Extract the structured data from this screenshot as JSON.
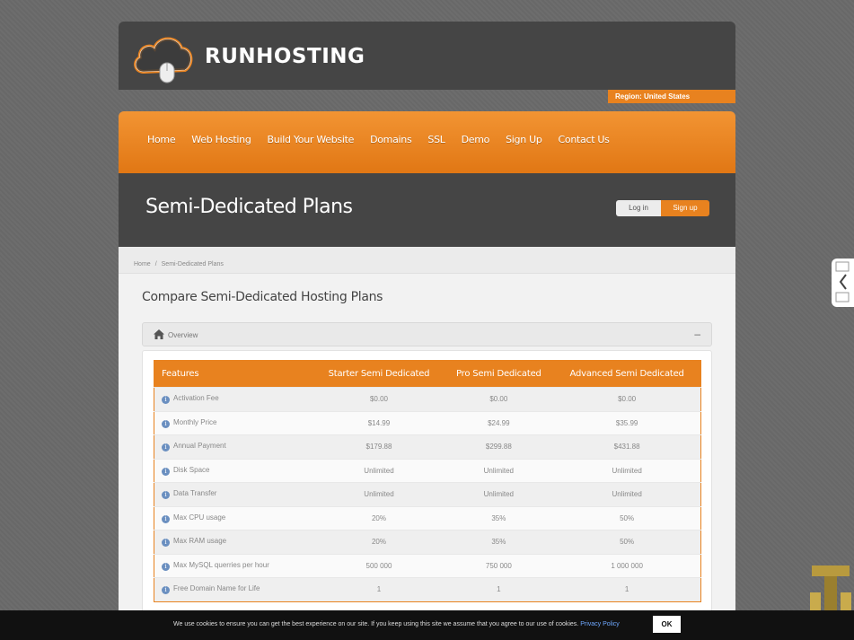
{
  "header": {
    "brand": "RUNHOSTING",
    "region": "Region: United States"
  },
  "nav": {
    "items": [
      {
        "label": "Home"
      },
      {
        "label": "Web Hosting"
      },
      {
        "label": "Build Your Website"
      },
      {
        "label": "Domains"
      },
      {
        "label": "SSL"
      },
      {
        "label": "Demo"
      },
      {
        "label": "Sign Up"
      },
      {
        "label": "Contact Us"
      }
    ]
  },
  "hero": {
    "title": "Semi-Dedicated Plans",
    "login_label": "Log in",
    "signup_label": "Sign up"
  },
  "breadcrumb": {
    "home": "Home",
    "separator": "/",
    "current": "Semi-Dedicated Plans"
  },
  "main": {
    "heading": "Compare Semi-Dedicated Hosting Plans",
    "accordion_label": "Overview",
    "accordion_toggle": "–"
  },
  "table": {
    "columns": [
      "Features",
      "Starter Semi Dedicated",
      "Pro Semi Dedicated",
      "Advanced Semi Dedicated"
    ],
    "rows": [
      [
        "Activation Fee",
        "$0.00",
        "$0.00",
        "$0.00"
      ],
      [
        "Monthly Price",
        "$14.99",
        "$24.99",
        "$35.99"
      ],
      [
        "Annual Payment",
        "$179.88",
        "$299.88",
        "$431.88"
      ],
      [
        "Disk Space",
        "Unlimited",
        "Unlimited",
        "Unlimited"
      ],
      [
        "Data Transfer",
        "Unlimited",
        "Unlimited",
        "Unlimited"
      ],
      [
        "Max CPU usage",
        "20%",
        "35%",
        "50%"
      ],
      [
        "Max RAM usage",
        "20%",
        "35%",
        "50%"
      ],
      [
        "Max MySQL querries per hour",
        "500 000",
        "750 000",
        "1 000 000"
      ],
      [
        "Free Domain Name for Life",
        "1",
        "1",
        "1"
      ]
    ],
    "info_glyph": "i"
  },
  "cookie": {
    "message": "We use cookies to ensure you can get the best experience on our site. If you keep using this site we assume that you agree to our use of cookies.",
    "policy_link": "Privacy Policy",
    "ok_label": "OK"
  },
  "colors": {
    "accent": "#e8821f",
    "dark": "#454545",
    "background": "#6a6a6a"
  }
}
